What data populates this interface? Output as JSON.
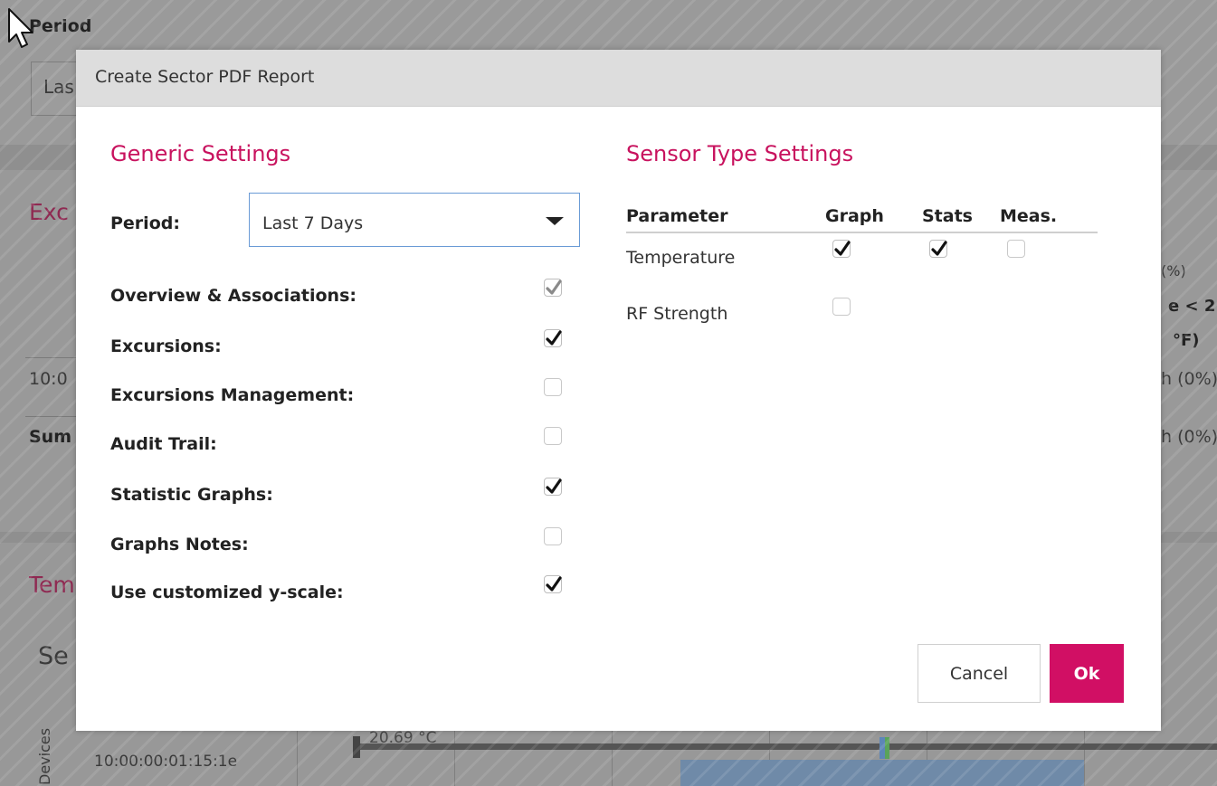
{
  "background": {
    "period_label": "Period",
    "period_value": "Las",
    "excursions_heading": "Exc",
    "row_time": "10:0",
    "summary_label": "Sum",
    "temperature_heading": "Tem",
    "sensor_heading": "Se",
    "devices_label": "Devices",
    "device_id": "10:00:00:01:15:1e",
    "graph_value": "20.69 °C",
    "right_col": [
      "(%)",
      "e < 2.",
      "°F)",
      "h (0%)",
      "h (0%)"
    ]
  },
  "dialog": {
    "title": "Create Sector PDF Report",
    "generic": {
      "heading": "Generic Settings",
      "period_label": "Period:",
      "period_value": "Last 7 Days",
      "options": [
        {
          "label": "Overview & Associations:",
          "checked": true,
          "disabled": true
        },
        {
          "label": "Excursions:",
          "checked": true,
          "disabled": false
        },
        {
          "label": "Excursions Management:",
          "checked": false,
          "disabled": false
        },
        {
          "label": "Audit Trail:",
          "checked": false,
          "disabled": false
        },
        {
          "label": "Statistic Graphs:",
          "checked": true,
          "disabled": false
        },
        {
          "label": "Graphs Notes:",
          "checked": false,
          "disabled": false
        },
        {
          "label": "Use customized y-scale:",
          "checked": true,
          "disabled": false
        }
      ]
    },
    "sensor": {
      "heading": "Sensor Type Settings",
      "columns": [
        "Parameter",
        "Graph",
        "Stats",
        "Meas."
      ],
      "rows": [
        {
          "name": "Temperature",
          "graph": true,
          "stats": true,
          "meas": false
        },
        {
          "name": "RF Strength",
          "graph": false
        }
      ]
    },
    "buttons": {
      "cancel": "Cancel",
      "ok": "Ok"
    }
  },
  "colors": {
    "accent": "#c8125e",
    "ok_button": "#d10f64",
    "select_border": "#6a9bd6",
    "header_bg": "#dddddd"
  },
  "icons": {
    "checkbox_check": "check-icon",
    "select_caret": "caret-down-icon",
    "cursor": "mouse-pointer-icon"
  }
}
